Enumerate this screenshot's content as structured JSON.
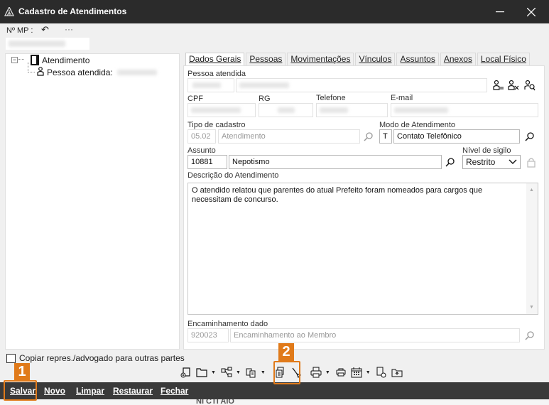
{
  "window": {
    "title": "Cadastro de Atendimentos",
    "minimize_glyph": "—",
    "close_glyph": "✕"
  },
  "mp": {
    "label": "Nº MP :",
    "undo_glyph": "↶",
    "more_glyph": "···"
  },
  "tree": {
    "root_label": "Atendimento",
    "child_label": "Pessoa atendida:",
    "toggle_glyph": "−"
  },
  "copy_checkbox_label": "Copiar repres./advogado para outras partes",
  "tabs": [
    {
      "label": "Dados Gerais",
      "active": true
    },
    {
      "label": "Pessoas",
      "active": false
    },
    {
      "label": "Movimentações",
      "active": false
    },
    {
      "label": "Vínculos",
      "active": false
    },
    {
      "label": "Assuntos",
      "active": false
    },
    {
      "label": "Anexos",
      "active": false
    },
    {
      "label": "Local Físico",
      "active": false
    }
  ],
  "form": {
    "pessoa_label": "Pessoa atendida",
    "cpf_label": "CPF",
    "rg_label": "RG",
    "telefone_label": "Telefone",
    "email_label": "E-mail",
    "tipo_label": "Tipo de cadastro",
    "tipo_code": "05.02",
    "tipo_value": "Atendimento",
    "modo_label": "Modo de Atendimento",
    "modo_code": "T",
    "modo_value": "Contato Telefônico",
    "assunto_label": "Assunto",
    "assunto_code": "10881",
    "assunto_value": "Nepotismo",
    "sigilo_label": "Nível de sigilo",
    "sigilo_value": "Restrito",
    "descricao_label": "Descrição do Atendimento",
    "descricao_text": "O atendido relatou que parentes do atual Prefeito foram nomeados para cargos que necessitam de concurso.",
    "encaminhamento_label": "Encaminhamento dado",
    "encaminhamento_code": "920023",
    "encaminhamento_value": "Encaminhamento ao Membro"
  },
  "bottom_buttons": {
    "salvar": "Salvar",
    "novo": "Novo",
    "limpar": "Limpar",
    "restaurar": "Restaurar",
    "fechar": "Fechar"
  },
  "callouts": {
    "one": "1",
    "two": "2"
  },
  "below_text": "NI CTI AIO",
  "colors": {
    "titlebar": "#2b2b2b",
    "bottombar": "#3a3a3a",
    "callout": "#e07a1a"
  }
}
